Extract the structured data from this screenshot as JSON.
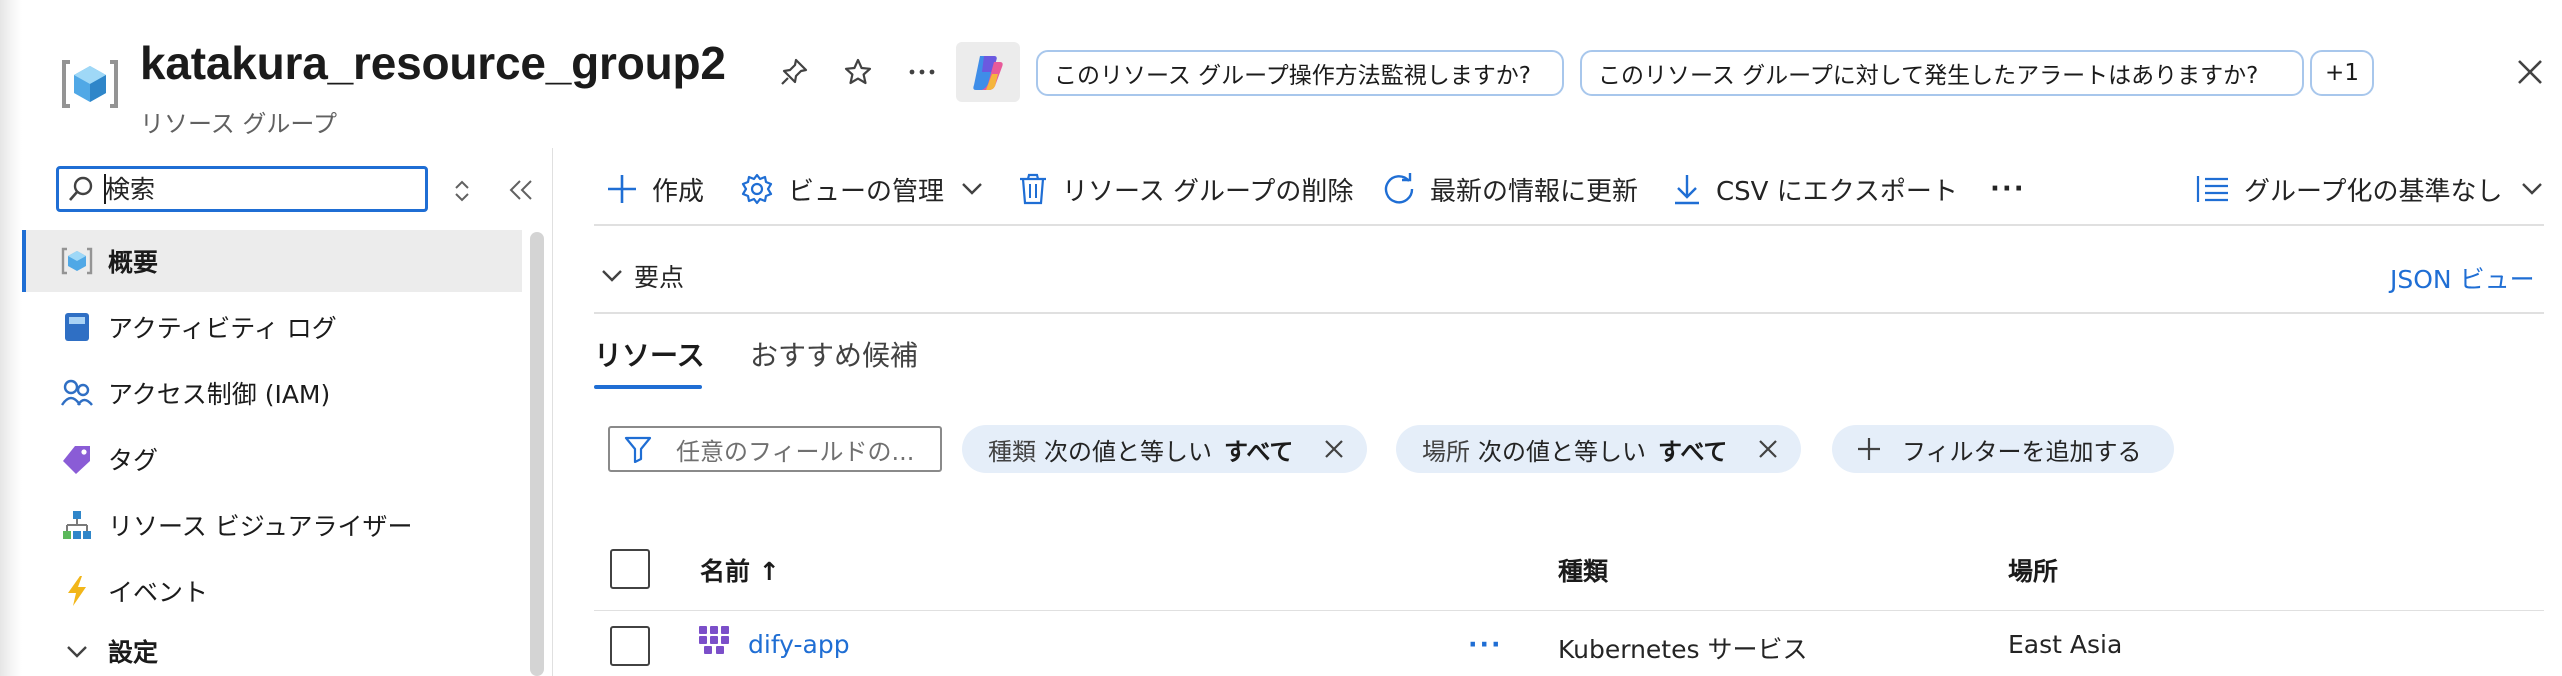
{
  "header": {
    "title": "katakura_resource_group2",
    "subtitle": "リソース グループ",
    "suggestions": [
      "このリソース グループ操作方法監視しますか?",
      "このリソース グループに対して発生したアラートはありますか?",
      "+1"
    ]
  },
  "sidebar": {
    "search_value": "検索",
    "items": [
      {
        "label": "概要",
        "icon": "resource-group-icon",
        "active": true
      },
      {
        "label": "アクティビティ ログ",
        "icon": "activity-log-icon"
      },
      {
        "label": "アクセス制御 (IAM)",
        "icon": "people-icon"
      },
      {
        "label": "タグ",
        "icon": "tag-icon"
      },
      {
        "label": "リソース ビジュアライザー",
        "icon": "hierarchy-icon"
      },
      {
        "label": "イベント",
        "icon": "lightning-icon"
      },
      {
        "label": "設定",
        "icon": "chevron-down-icon"
      }
    ]
  },
  "toolbar": {
    "create": "作成",
    "manage_view": "ビューの管理",
    "delete": "リソース グループの削除",
    "refresh": "最新の情報に更新",
    "export": "CSV にエクスポート",
    "more": "···",
    "grouping": "グループ化の基準なし"
  },
  "essentials": {
    "label": "要点",
    "json_view": "JSON ビュー"
  },
  "tabs": [
    "リソース",
    "おすすめ候補"
  ],
  "filters": {
    "placeholder": "任意のフィールドの...",
    "pills": [
      {
        "key": "種類",
        "op": "次の値と等しい",
        "value": "すべて"
      },
      {
        "key": "場所",
        "op": "次の値と等しい",
        "value": "すべて"
      }
    ],
    "add_filter": "フィルターを追加する"
  },
  "table": {
    "columns": [
      "名前 ↑",
      "種類",
      "場所"
    ],
    "rows": [
      {
        "name": "dify-app",
        "more": "···",
        "type": "Kubernetes サービス",
        "location": "East Asia"
      }
    ]
  },
  "colors": {
    "accent": "#1f6ed4",
    "pill_bg": "#e5eef9",
    "chip_border": "#a8c7ec"
  }
}
